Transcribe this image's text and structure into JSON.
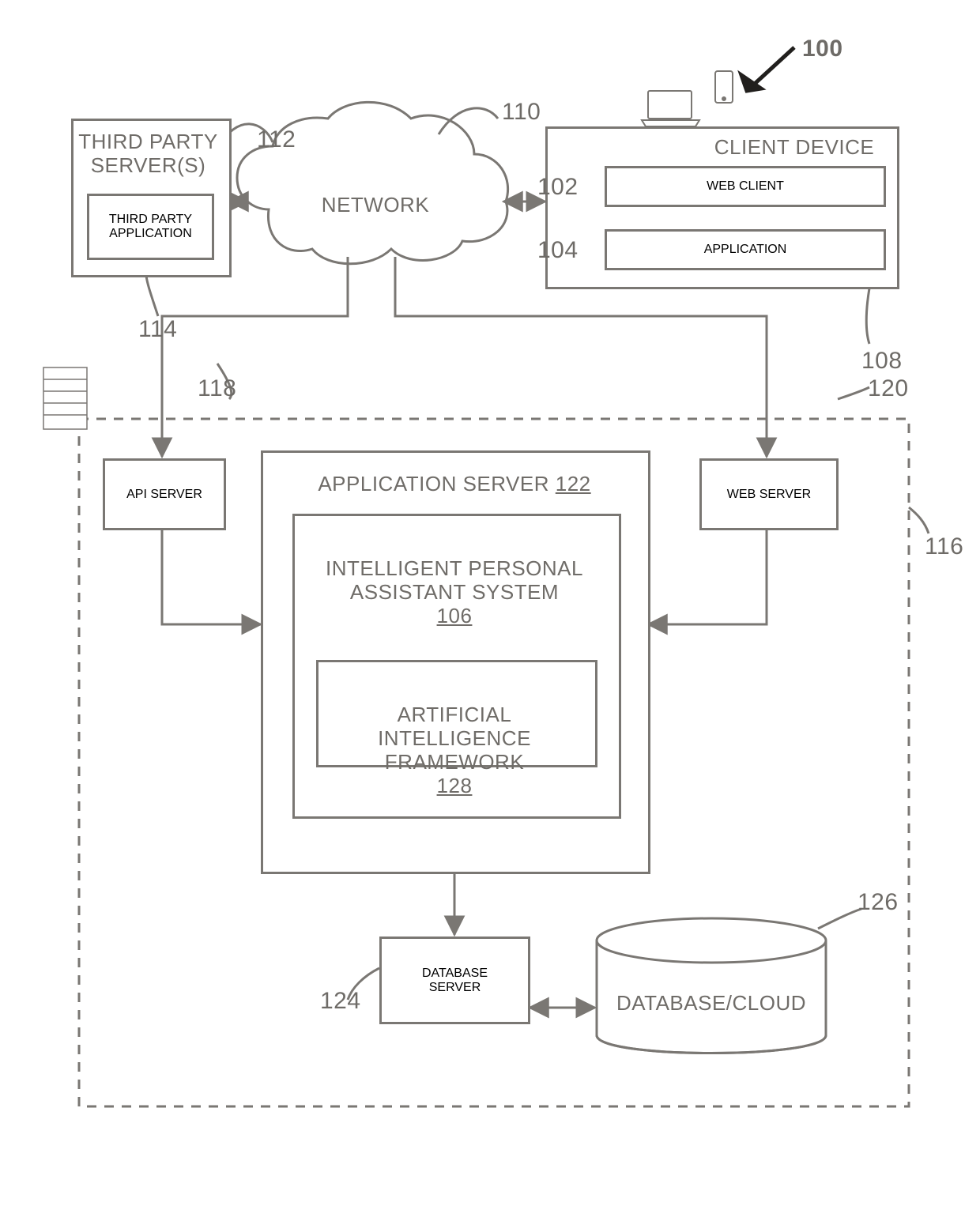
{
  "figure_ref": "100",
  "labels": {
    "third_party_servers": "THIRD PARTY\nSERVER(S)",
    "third_party_application": "THIRD PARTY\nAPPLICATION",
    "network": "NETWORK",
    "client_device": "CLIENT DEVICE",
    "web_client": "WEB CLIENT",
    "application": "APPLICATION",
    "api_server": "API SERVER",
    "application_server": "APPLICATION SERVER",
    "application_server_ref": "122",
    "ipa_system": "INTELLIGENT PERSONAL\nASSISTANT SYSTEM",
    "ipa_system_ref": "106",
    "ai_framework": "ARTIFICIAL INTELLIGENCE\nFRAMEWORK",
    "ai_framework_ref": "128",
    "web_server": "WEB SERVER",
    "database_server": "DATABASE\nSERVER",
    "database_cloud": "DATABASE/CLOUD"
  },
  "refs": {
    "n100": "100",
    "n102": "102",
    "n104": "104",
    "n108": "108",
    "n110": "110",
    "n112": "112",
    "n114": "114",
    "n116": "116",
    "n118": "118",
    "n120": "120",
    "n124": "124",
    "n126": "126"
  }
}
